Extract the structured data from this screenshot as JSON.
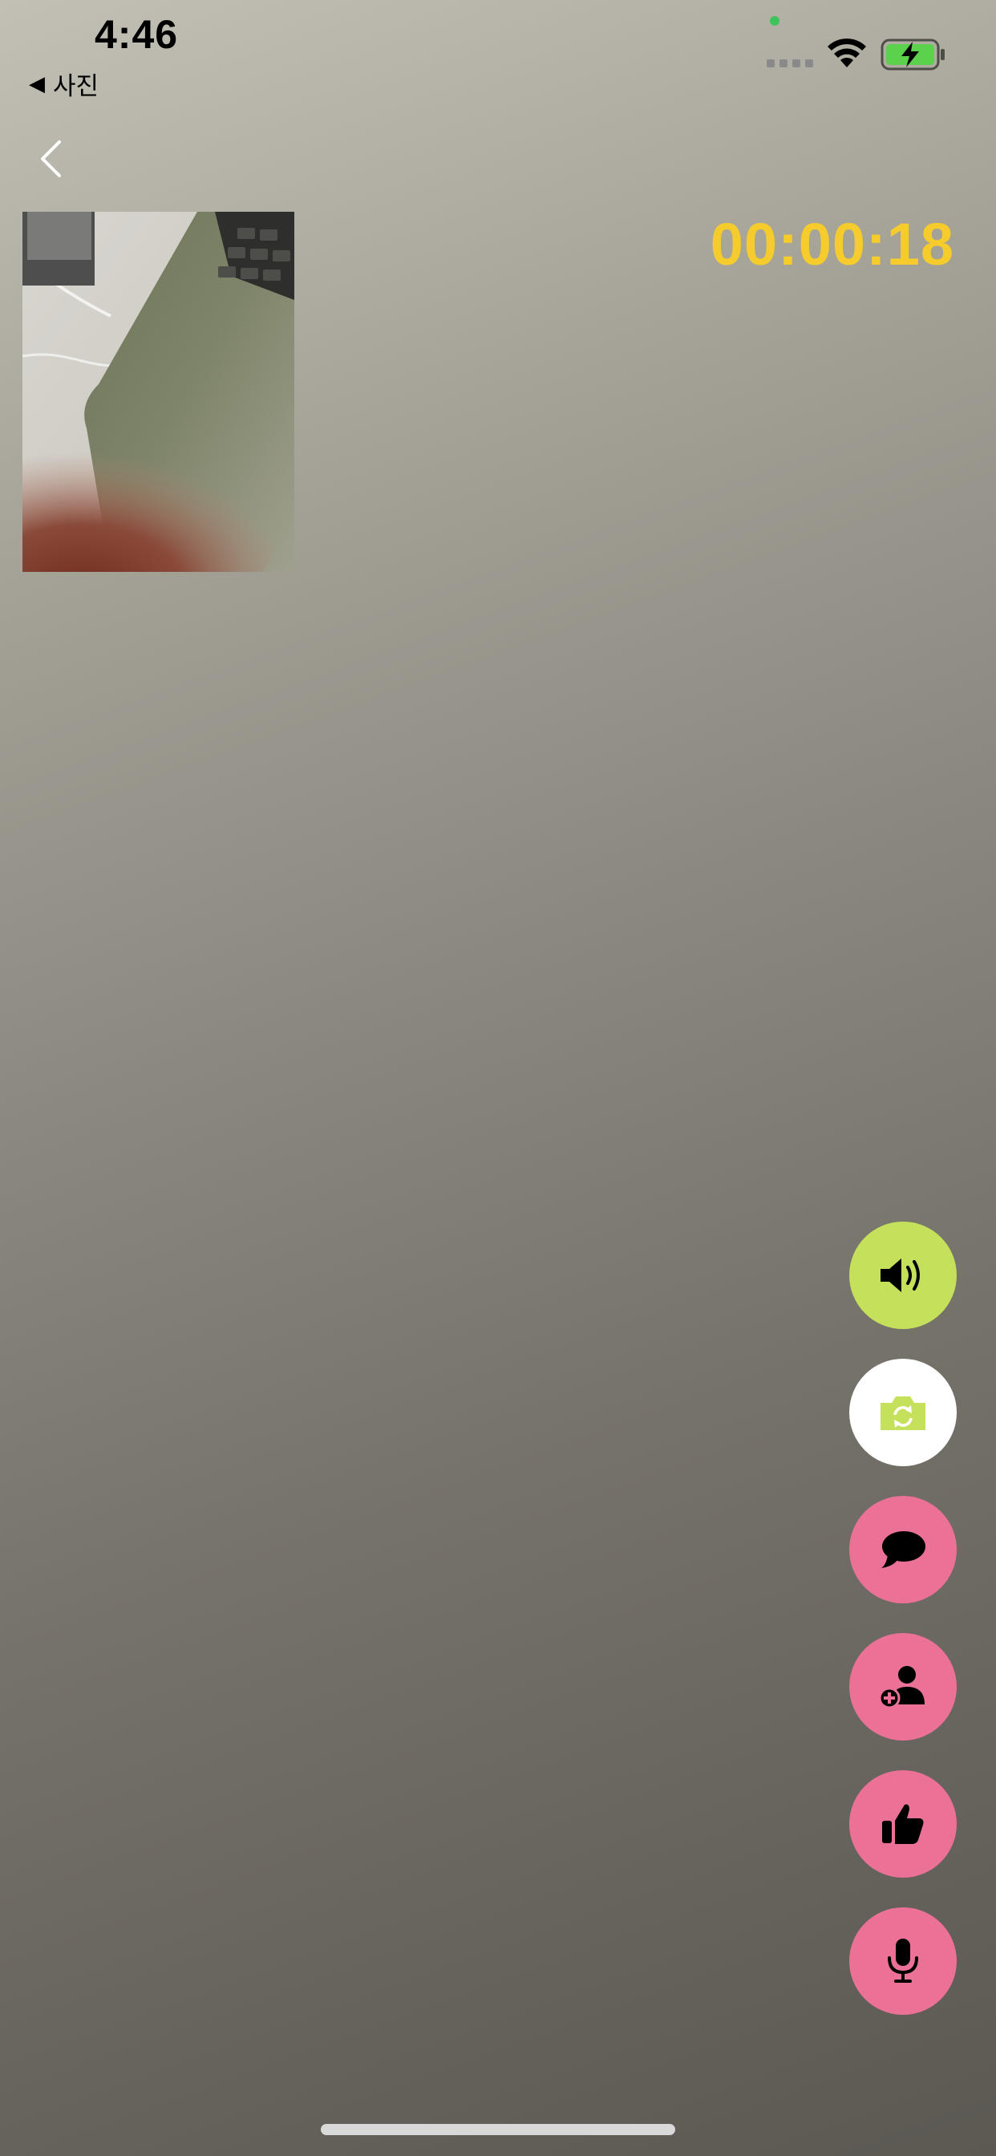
{
  "status_bar": {
    "time": "4:46",
    "back_app_label": "사진",
    "wifi_icon": "wifi-icon",
    "battery_icon": "battery-charging-icon"
  },
  "call": {
    "timer": "00:00:18",
    "timer_color": "#f5cc2c"
  },
  "nav": {
    "back_icon": "chevron-left-icon"
  },
  "actions": [
    {
      "name": "speaker",
      "icon": "speaker-icon",
      "color": "#c5e05a"
    },
    {
      "name": "switch-camera",
      "icon": "camera-rotate-icon",
      "color": "#ffffff"
    },
    {
      "name": "chat",
      "icon": "chat-bubble-icon",
      "color": "#eb7196"
    },
    {
      "name": "add-friend",
      "icon": "person-add-icon",
      "color": "#eb7196"
    },
    {
      "name": "like",
      "icon": "thumbs-up-icon",
      "color": "#eb7196"
    },
    {
      "name": "microphone",
      "icon": "microphone-icon",
      "color": "#eb7196"
    }
  ]
}
